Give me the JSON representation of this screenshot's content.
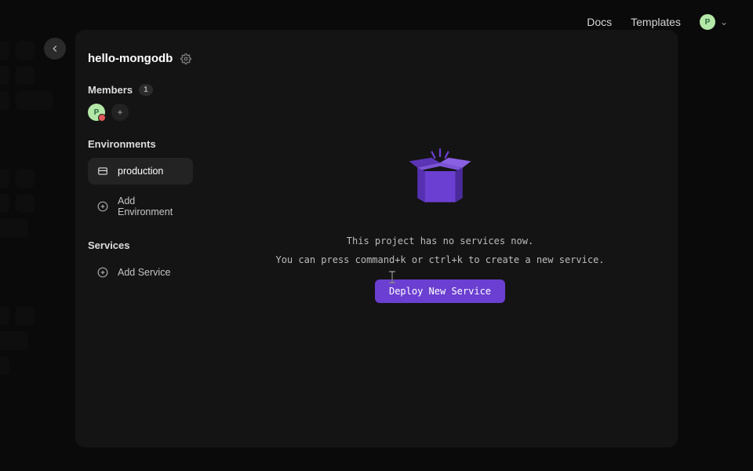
{
  "topnav": {
    "docs": "Docs",
    "templates": "Templates",
    "avatar_initial": "P"
  },
  "back_aria": "←",
  "project": {
    "title": "hello-mongodb"
  },
  "members": {
    "label": "Members",
    "count": "1",
    "avatar_initial": "P"
  },
  "environments": {
    "label": "Environments",
    "items": [
      {
        "name": "production",
        "active": true
      }
    ],
    "add_label": "Add Environment"
  },
  "services": {
    "label": "Services",
    "add_label": "Add Service"
  },
  "empty": {
    "line1": "This project has no services now.",
    "line2": "You can press command+k or ctrl+k to create a new service.",
    "button": "Deploy New Service"
  }
}
